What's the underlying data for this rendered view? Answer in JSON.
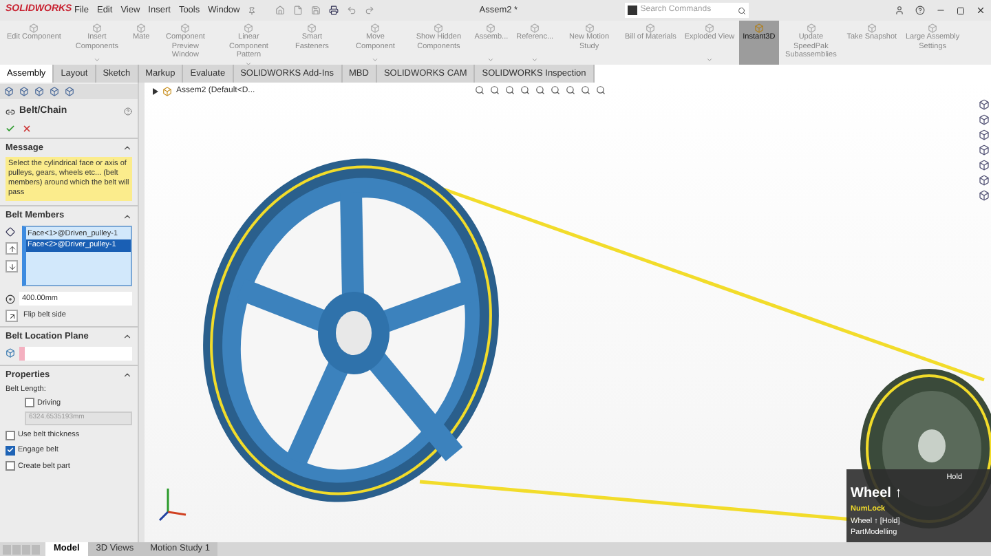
{
  "title_bar": {
    "logo": "SOLIDWORKS",
    "menu": [
      "File",
      "Edit",
      "View",
      "Insert",
      "Tools",
      "Window"
    ],
    "document_title": "Assem2 *",
    "search": {
      "placeholder": "Search Commands"
    }
  },
  "ribbon": [
    {
      "label": "Edit Component",
      "dropdown": false,
      "selected": false
    },
    {
      "label": "Insert Components",
      "dropdown": true,
      "selected": false
    },
    {
      "label": "Mate",
      "dropdown": false,
      "selected": false
    },
    {
      "label": "Component Preview Window",
      "dropdown": false,
      "selected": false
    },
    {
      "label": "Linear Component Pattern",
      "dropdown": true,
      "selected": false
    },
    {
      "label": "Smart Fasteners",
      "dropdown": false,
      "selected": false
    },
    {
      "label": "Move Component",
      "dropdown": true,
      "selected": false
    },
    {
      "label": "Show Hidden Components",
      "dropdown": false,
      "selected": false
    },
    {
      "label": "Assemb...",
      "dropdown": true,
      "selected": false
    },
    {
      "label": "Referenc...",
      "dropdown": true,
      "selected": false
    },
    {
      "label": "New Motion Study",
      "dropdown": false,
      "selected": false
    },
    {
      "label": "Bill of Materials",
      "dropdown": false,
      "selected": false
    },
    {
      "label": "Exploded View",
      "dropdown": true,
      "selected": false
    },
    {
      "label": "Instant3D",
      "dropdown": false,
      "selected": true
    },
    {
      "label": "Update SpeedPak Subassemblies",
      "dropdown": false,
      "selected": false
    },
    {
      "label": "Take Snapshot",
      "dropdown": false,
      "selected": false
    },
    {
      "label": "Large Assembly Settings",
      "dropdown": false,
      "selected": false
    }
  ],
  "tabs": [
    {
      "label": "Assembly",
      "selected": true
    },
    {
      "label": "Layout",
      "selected": false
    },
    {
      "label": "Sketch",
      "selected": false
    },
    {
      "label": "Markup",
      "selected": false
    },
    {
      "label": "Evaluate",
      "selected": false
    },
    {
      "label": "SOLIDWORKS Add-Ins",
      "selected": false
    },
    {
      "label": "MBD",
      "selected": false
    },
    {
      "label": "SOLIDWORKS CAM",
      "selected": false
    },
    {
      "label": "SOLIDWORKS Inspection",
      "selected": false
    }
  ],
  "feature_tree": {
    "item": "Assem2  (Default<D..."
  },
  "property_manager": {
    "title": "Belt/Chain",
    "message": {
      "heading": "Message",
      "text": "Select the cylindrical face or axis of pulleys, gears, wheels etc... (belt members) around which the belt will pass"
    },
    "belt_members": {
      "heading": "Belt Members",
      "items": [
        {
          "label": "Face<1>@Driven_pulley-1",
          "selected": false
        },
        {
          "label": "Face<2>@Driver_pulley-1",
          "selected": true
        }
      ],
      "distance": "400.00mm",
      "flip": "Flip belt side"
    },
    "belt_location_plane": {
      "heading": "Belt Location Plane"
    },
    "properties": {
      "heading": "Properties",
      "belt_length_label": "Belt Length:",
      "driving": {
        "label": "Driving",
        "checked": false
      },
      "belt_length": "6324.6535193mm",
      "options": [
        {
          "label": "Use belt thickness",
          "checked": false
        },
        {
          "label": "Engage belt",
          "checked": true
        },
        {
          "label": "Create belt part",
          "checked": false
        }
      ]
    }
  },
  "tooltip": {
    "corner": "Hold",
    "title": "Wheel ↑",
    "lines": [
      "NumLock",
      "Wheel ↑ [Hold]",
      "PartModelling"
    ]
  },
  "bottom_tabs": [
    {
      "label": "Model",
      "selected": true
    },
    {
      "label": "3D Views",
      "selected": false
    },
    {
      "label": "Motion Study 1",
      "selected": false
    }
  ]
}
